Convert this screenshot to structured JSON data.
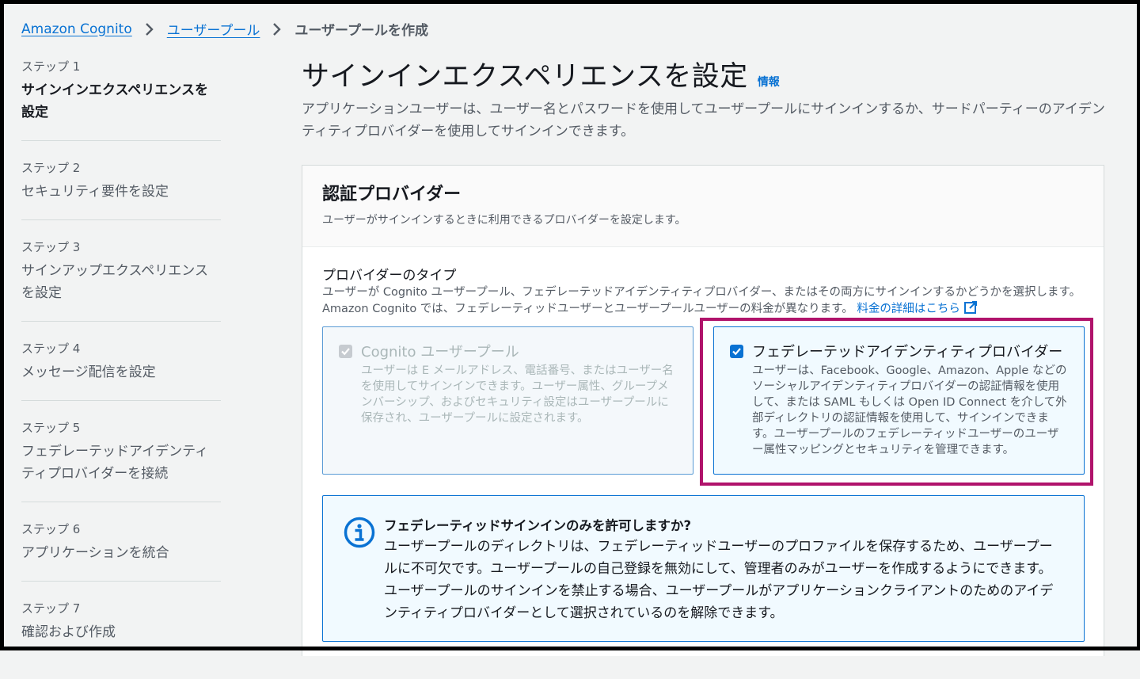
{
  "breadcrumb": {
    "items": [
      "Amazon Cognito",
      "ユーザープール"
    ],
    "current": "ユーザープールを作成"
  },
  "sidebar": {
    "steps": [
      {
        "num": "ステップ 1",
        "title": "サインインエクスペリエンスを設定",
        "active": true
      },
      {
        "num": "ステップ 2",
        "title": "セキュリティ要件を設定"
      },
      {
        "num": "ステップ 3",
        "title": "サインアップエクスペリエンスを設定"
      },
      {
        "num": "ステップ 4",
        "title": "メッセージ配信を設定"
      },
      {
        "num": "ステップ 5",
        "title": "フェデレーテッドアイデンティティプロバイダーを接続"
      },
      {
        "num": "ステップ 6",
        "title": "アプリケーションを統合"
      },
      {
        "num": "ステップ 7",
        "title": "確認および作成"
      }
    ]
  },
  "header": {
    "title": "サインインエクスペリエンスを設定",
    "info": "情報",
    "description": "アプリケーションユーザーは、ユーザー名とパスワードを使用してユーザープールにサインインするか、サードパーティーのアイデンティティプロバイダーを使用してサインインできます。"
  },
  "providers": {
    "title": "認証プロバイダー",
    "description": "ユーザーがサインインするときに利用できるプロバイダーを設定します。",
    "type_label": "プロバイダーのタイプ",
    "type_description": "ユーザーが Cognito ユーザープール、フェデレーテッドアイデンティティプロバイダー、またはその両方にサインインするかどうかを選択します。Amazon Cognito では、フェデレーティッドユーザーとユーザープールユーザーの料金が異なります。",
    "pricing_link": "料金の詳細はこちら",
    "options": [
      {
        "title": "Cognito ユーザープール",
        "description": "ユーザーは E メールアドレス、電話番号、またはユーザー名を使用してサインインできます。ユーザー属性、グループメンバーシップ、およびセキュリティ設定はユーザープールに保存され、ユーザープールに設定されます。",
        "checked": true,
        "disabled": true
      },
      {
        "title": "フェデレーテッドアイデンティティプロバイダー",
        "description": "ユーザーは、Facebook、Google、Amazon、Apple などのソーシャルアイデンティティプロバイダーの認証情報を使用して、または SAML もしくは Open ID Connect を介して外部ディレクトリの認証情報を使用して、サインインできます。ユーザープールのフェデレーティッドユーザーのユーザー属性マッピングとセキュリティを管理できます。",
        "checked": true,
        "disabled": false
      }
    ],
    "alert": {
      "title": "フェデレーティッドサインインのみを許可しますか?",
      "body": "ユーザープールのディレクトリは、フェデレーティッドユーザーのプロファイルを保存するため、ユーザープールに不可欠です。ユーザープールの自己登録を無効にして、管理者のみがユーザーを作成するようにできます。ユーザープールのサインインを禁止する場合、ユーザープールがアプリケーションクライアントのためのアイデンティティプロバイダーとして選択されているのを解除できます。"
    }
  },
  "colors": {
    "link": "#0972d3",
    "highlight": "#b0136b",
    "text": "#16191f",
    "muted": "#545b64"
  }
}
